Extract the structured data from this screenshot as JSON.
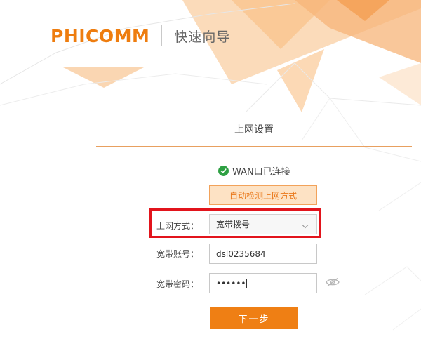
{
  "header": {
    "logo_text": "PHICOMM",
    "wizard_title": "快速向导"
  },
  "section": {
    "title": "上网设置"
  },
  "status": {
    "text": "WAN口已连接",
    "icon": "check-circle-icon"
  },
  "detect_button": {
    "label": "自动检测上网方式"
  },
  "form": {
    "connection_type": {
      "label": "上网方式：",
      "value": "宽带拨号"
    },
    "account": {
      "label": "宽带账号：",
      "value": "dsl0235684"
    },
    "password": {
      "label": "宽带密码：",
      "value": "••••••"
    }
  },
  "next_button": {
    "label": "下一步"
  },
  "colors": {
    "accent": "#ef7f14",
    "highlight": "#e2141c",
    "success": "#2ea043"
  }
}
